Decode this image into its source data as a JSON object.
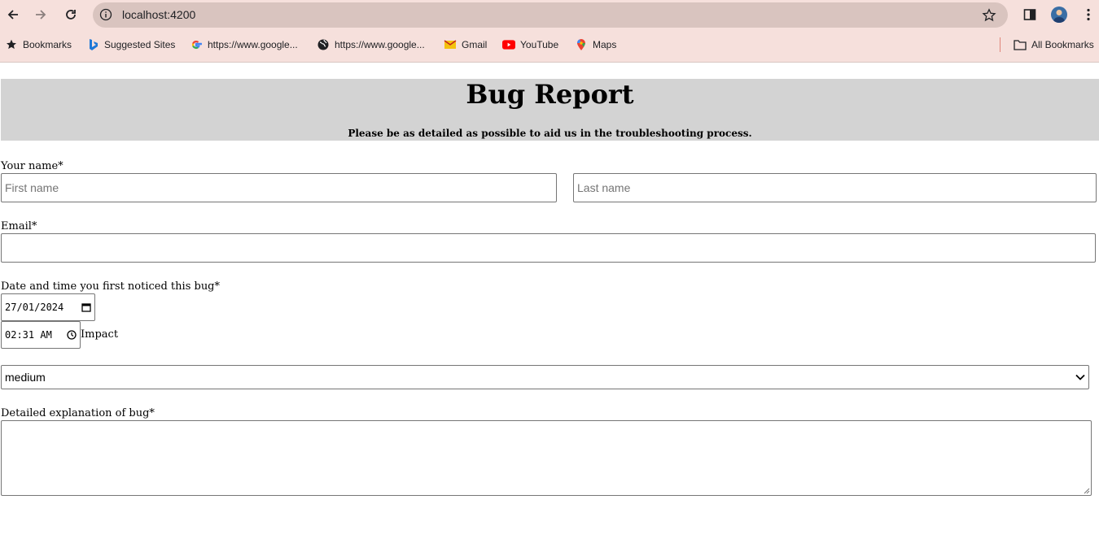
{
  "browser": {
    "url": "localhost:4200",
    "bookmarks": [
      {
        "label": "Bookmarks",
        "icon": "star-icon"
      },
      {
        "label": "Suggested Sites",
        "icon": "bing-icon"
      },
      {
        "label": "https://www.google...",
        "icon": "google-icon"
      },
      {
        "label": "https://www.google...",
        "icon": "globe-icon"
      },
      {
        "label": "Gmail",
        "icon": "gmail-icon"
      },
      {
        "label": "YouTube",
        "icon": "youtube-icon"
      },
      {
        "label": "Maps",
        "icon": "maps-icon"
      }
    ],
    "all_bookmarks": "All Bookmarks"
  },
  "page": {
    "title": "Bug Report",
    "subtitle": "Please be as detailed as possible to aid us in the troubleshooting process.",
    "name_label": "Your name*",
    "first_name_placeholder": "First name",
    "last_name_placeholder": "Last name",
    "email_label": "Email*",
    "datetime_label": "Date and time you first noticed this bug*",
    "date_value": "27/01/2024",
    "time_value": "02:31 AM",
    "impact_label": "Impact",
    "impact_value": "medium",
    "explanation_label": "Detailed explanation of bug*"
  }
}
